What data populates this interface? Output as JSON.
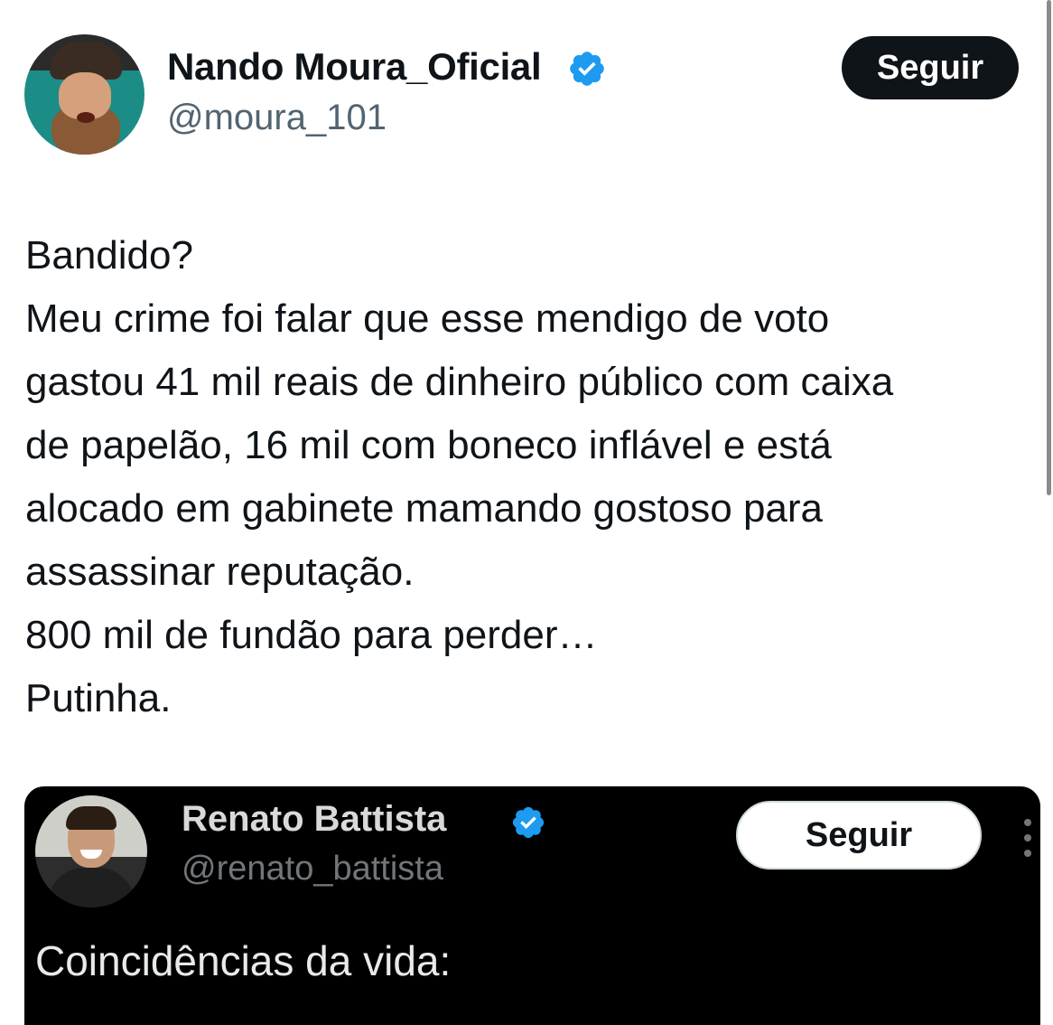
{
  "author": {
    "display_name": "Nando Moura_Oficial",
    "handle": "@moura_101",
    "verified": true,
    "avatar_icon": "avatar-photo"
  },
  "follow_label": "Seguir",
  "tweet": {
    "lines": [
      "Bandido?",
      "Meu crime foi falar que esse mendigo de voto",
      "gastou 41 mil reais de dinheiro público com caixa",
      "de papelão, 16 mil com boneco inflável e está",
      "alocado em gabinete mamando gostoso para",
      "assassinar reputação.",
      "800 mil de fundão para perder…",
      "Putinha."
    ]
  },
  "quoted": {
    "display_name": "Renato Battista",
    "handle": "@renato_battista",
    "verified": true,
    "follow_label": "Seguir",
    "text": "Coincidências da vida:",
    "background": "#000000"
  },
  "colors": {
    "verified": "#1d9bf0",
    "primary_text": "#0f1419",
    "secondary_text": "#536471"
  }
}
